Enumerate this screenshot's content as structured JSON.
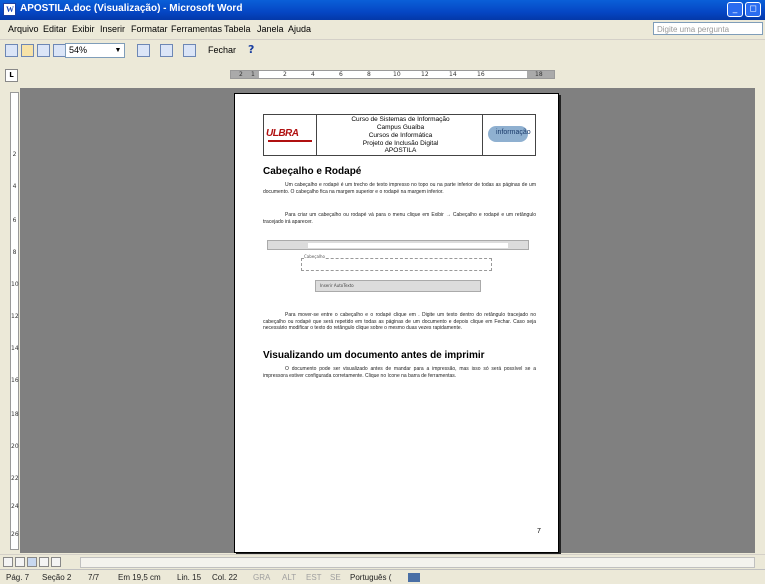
{
  "window": {
    "title": "APOSTILA.doc (Visualização) - Microsoft Word",
    "app_icon": "W"
  },
  "menubar": {
    "items": [
      "Arquivo",
      "Editar",
      "Exibir",
      "Inserir",
      "Formatar",
      "Ferramentas",
      "Tabela",
      "Janela",
      "Ajuda"
    ],
    "help_placeholder": "Digite uma pergunta"
  },
  "toolbar": {
    "zoom": "54%",
    "close_label": "Fechar",
    "help_icon": "?"
  },
  "ruler": {
    "corner": "L",
    "h_ticks": [
      "2",
      "1",
      "2",
      "4",
      "6",
      "8",
      "10",
      "12",
      "14",
      "16",
      "18"
    ],
    "v_ticks": [
      "2",
      "4",
      "6",
      "8",
      "10",
      "12",
      "14",
      "16",
      "18",
      "20",
      "22",
      "24",
      "26"
    ]
  },
  "document": {
    "header": {
      "logo_left": "ULBRA",
      "logo_right": "informação",
      "lines": [
        "Curso de Sistemas de Informação",
        "Campus Guaíba",
        "Cursos de Informática",
        "Projeto de Inclusão Digital",
        "APOSTILA"
      ]
    },
    "section1_title": "Cabeçalho e Rodapé",
    "p1": "Um cabeçalho e rodapé é um trecho de texto impresso no topo ou na parte inferior de todas as páginas de um documento. O cabeçalho fica na margem superior e o rodapé na margem inferior.",
    "p2": "Para criar um cabeçalho ou rodapé vá para o menu clique em Exibir → Cabeçalho e rodapé e um retângulo tracejado irá aparecer.",
    "fig_header_label": "Cabeçalho",
    "fig_toolbar_label": "Inserir AutoTexto",
    "p3": "Para mover-se entre o cabeçalho e o rodapé clique em . Digite um texto dentro do retângulo tracejado no cabeçalho ou rodapé que será repetido em todas as páginas de um documento e depois clique em Fechar. Caso seja necessário modificar o texto do retângulo clique sobre o mesmo duas vezes rapidamente.",
    "section2_title": "Visualizando um documento antes de imprimir",
    "p4": "O documento pode ser visualizado antes de mandar para a impressão, mas isso só será possível se a impressora estiver configurada corretamente. Clique no ícone na barra de ferramentas.",
    "page_number": "7"
  },
  "statusbar": {
    "page": "Pág. 7",
    "section": "Seção 2",
    "of_pages": "7/7",
    "at": "Em 19,5 cm",
    "line": "Lin. 15",
    "col": "Col. 22",
    "rec": "GRA",
    "trk": "ALT",
    "ext": "EST",
    "ovr": "SE",
    "language": "Português (",
    "spell_icon": "book-check"
  }
}
